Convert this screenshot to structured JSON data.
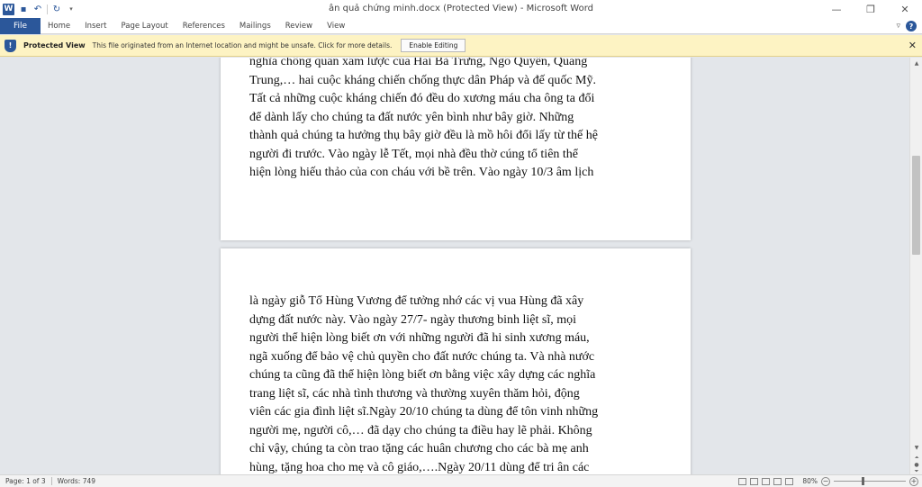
{
  "titlebar": {
    "title": "ân quả chứng minh.docx (Protected View) - Microsoft Word",
    "app_icon": "W",
    "minimize": "—",
    "restore": "❐",
    "close": "✕"
  },
  "ribbon": {
    "file_tab": "File",
    "tabs": [
      "Home",
      "Insert",
      "Page Layout",
      "References",
      "Mailings",
      "Review",
      "View"
    ],
    "help": "?"
  },
  "protected_view": {
    "label": "Protected View",
    "message": "This file originated from an Internet location and might be unsafe. Click for more details.",
    "enable_button": "Enable Editing",
    "close": "✕"
  },
  "document": {
    "page1_lines": [
      "nghĩa chống quân xâm lược của Hai Bà Trưng, Ngô Quyền, Quang",
      "Trung,… hai cuộc kháng chiến chống thực dân Pháp và đế quốc Mỹ.",
      "Tất cả những cuộc kháng chiến đó đều do xương máu cha ông ta đổi",
      "để dành lấy cho chúng ta đất nước yên bình như bây giờ. Những",
      "thành quả chúng ta hưởng thụ bây giờ đều là mồ hôi đổi lấy từ thế hệ",
      "người đi trước. Vào ngày lễ Tết, mọi nhà đều thờ cúng tổ tiên thể",
      "hiện lòng hiếu thảo của con cháu với bề trên. Vào ngày 10/3 âm lịch"
    ],
    "page2_lines": [
      "là ngày giỗ Tổ Hùng Vương để tưởng nhớ các vị vua Hùng đã xây",
      "dựng đất nước này. Vào ngày 27/7- ngày thương binh liệt sĩ, mọi",
      "người thể hiện lòng biết ơn với những người đã hi sinh xương máu,",
      "ngã xuống để bảo vệ chủ quyền cho đất nước chúng ta. Và nhà nước",
      "chúng ta cũng đã thể hiện lòng biết ơn bằng việc xây dựng các nghĩa",
      "trang liệt sĩ, các nhà tình thương và thường xuyên thăm hỏi, động",
      "viên các gia đình liệt sĩ.Ngày 20/10 chúng ta dùng để tôn vinh những",
      "người mẹ, người cô,… đã dạy cho chúng ta điều hay lẽ phải. Không",
      "chỉ vậy, chúng ta còn trao tặng các huân chương cho các bà mẹ anh",
      "hùng, tặng hoa cho mẹ và cô giáo,….Ngày 20/11 dùng để tri ân các"
    ]
  },
  "statusbar": {
    "page": "Page: 1 of 3",
    "words": "Words: 749",
    "zoom": "80%",
    "zoom_fraction": 0.4
  },
  "colors": {
    "brand": "#2b579a",
    "protected_bar": "#fdf3c3"
  }
}
